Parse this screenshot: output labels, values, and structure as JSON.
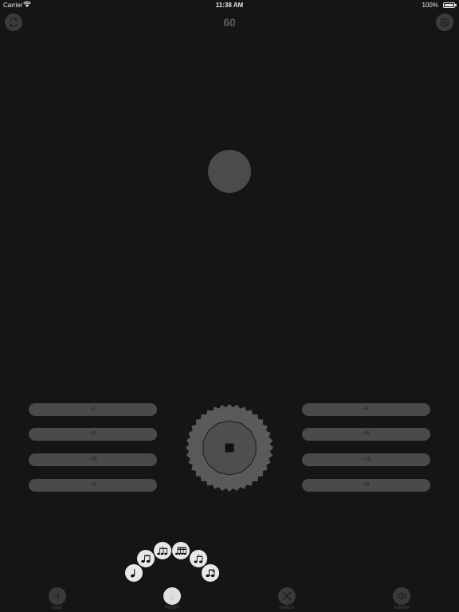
{
  "status_bar": {
    "carrier": "Carrier",
    "time": "11:38 AM",
    "battery": "100%"
  },
  "header": {
    "tempo": "60",
    "left_icon": "sync-icon",
    "right_icon": "gear-icon"
  },
  "left_steps": [
    "-1",
    "-5",
    "-10",
    "÷2"
  ],
  "right_steps": [
    "+1",
    "+5",
    "+10",
    "×2"
  ],
  "dial": {
    "center_icon": "stop-icon"
  },
  "rhythm_options": [
    "quarter-note-icon",
    "eighth-notes-icon",
    "triplet-icon",
    "sixteenth-notes-icon",
    "swing-triplet-icon",
    "dotted-eighth-sixteenth-icon"
  ],
  "tabs": [
    {
      "value": "4",
      "label": "beat"
    },
    {
      "value": "",
      "label": "rhythm"
    },
    {
      "value": "",
      "label": "motion"
    },
    {
      "value": "",
      "label": "volume"
    }
  ],
  "colors": {
    "background": "#151515",
    "control": "#4a4a4a",
    "rhythm_button": "#e8e8e8"
  }
}
